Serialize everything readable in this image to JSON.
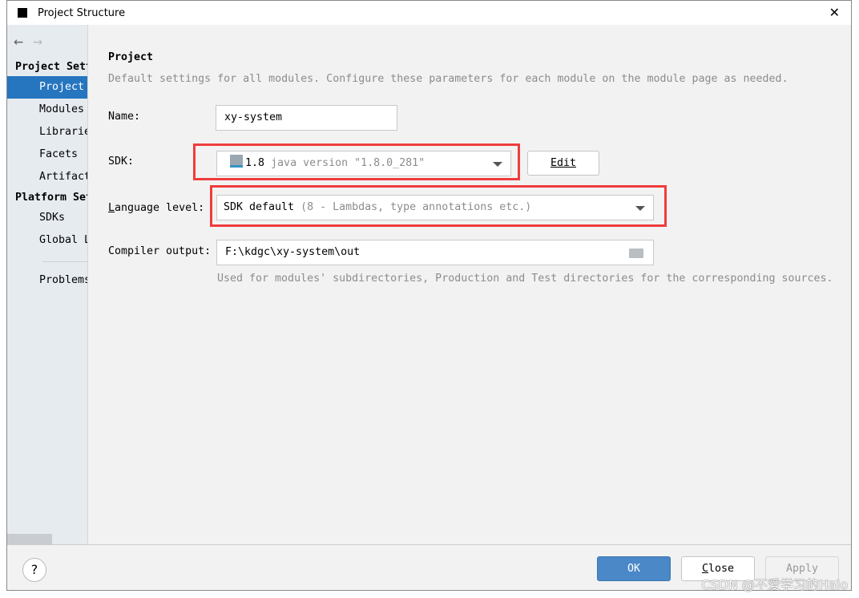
{
  "window": {
    "title": "Project Structure",
    "close": "✕"
  },
  "nav": {
    "back": "←",
    "forward": "→"
  },
  "sidebar": {
    "project_settings_header": "Project Settings",
    "project_settings": [
      "Project",
      "Modules",
      "Libraries",
      "Facets",
      "Artifacts"
    ],
    "platform_settings_header": "Platform Settings",
    "platform_settings": [
      "SDKs",
      "Global Libraries"
    ],
    "problems": "Problems",
    "selected": "Project"
  },
  "main": {
    "heading": "Project",
    "description": "Default settings for all modules. Configure these parameters for each module on the module page as needed.",
    "name_label": "Name:",
    "name_value": "xy-system",
    "sdk_label": "SDK:",
    "sdk_version": "1.8",
    "sdk_detail": "java version \"1.8.0_281\"",
    "edit_button": "Edit",
    "language_level_label_first": "L",
    "language_level_label_rest": "anguage level:",
    "language_level_value": "SDK default",
    "language_level_detail": "(8 - Lambdas, type annotations etc.)",
    "compiler_output_label": "Compiler output:",
    "compiler_output_value": "F:\\kdgc\\xy-system\\out",
    "compiler_output_hint": "Used for modules' subdirectories, Production and Test directories for the corresponding sources."
  },
  "footer": {
    "help": "?",
    "ok": "OK",
    "close_first": "C",
    "close_rest": "lose",
    "apply": "Apply"
  },
  "watermark": "CSDN @不爱学习的Halo",
  "colors": {
    "selection": "#2675bf",
    "ok_button": "#4a88c7",
    "highlight_box": "#f03c3c"
  }
}
